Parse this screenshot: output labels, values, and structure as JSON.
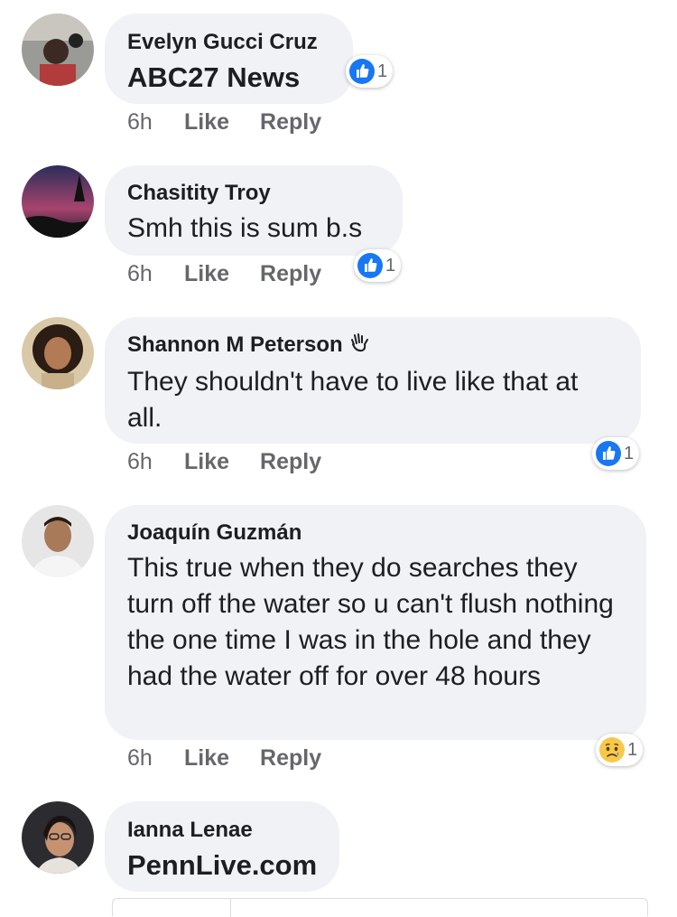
{
  "comments": [
    {
      "name": "Evelyn Gucci Cruz",
      "text": "ABC27 News",
      "time": "6h",
      "like": "Like",
      "reply": "Reply",
      "reaction": {
        "icon": "like-icon",
        "count": "1"
      }
    },
    {
      "name": "Chasitity Troy",
      "text": "Smh this is sum b.s",
      "time": "6h",
      "like": "Like",
      "reply": "Reply",
      "reaction": {
        "icon": "like-icon",
        "count": "1"
      }
    },
    {
      "name": "Shannon M Peterson",
      "badge": "wave-icon",
      "text": "They shouldn't have to live like that at all.",
      "time": "6h",
      "like": "Like",
      "reply": "Reply",
      "reaction": {
        "icon": "like-icon",
        "count": "1"
      }
    },
    {
      "name": "Joaquín Guzmán",
      "text": "This true when they do searches they turn off the water so u can't flush nothing the one time I was in the hole and they had the water off for over 48 hours",
      "time": "6h",
      "like": "Like",
      "reply": "Reply",
      "reaction": {
        "icon": "sad-icon",
        "count": "1"
      }
    },
    {
      "name": "Ianna Lenae",
      "text": "PennLive.com"
    }
  ],
  "colors": {
    "like_blue": "#1877f2",
    "bubble_bg": "#f0f2f5",
    "meta_gray": "#65676b"
  }
}
